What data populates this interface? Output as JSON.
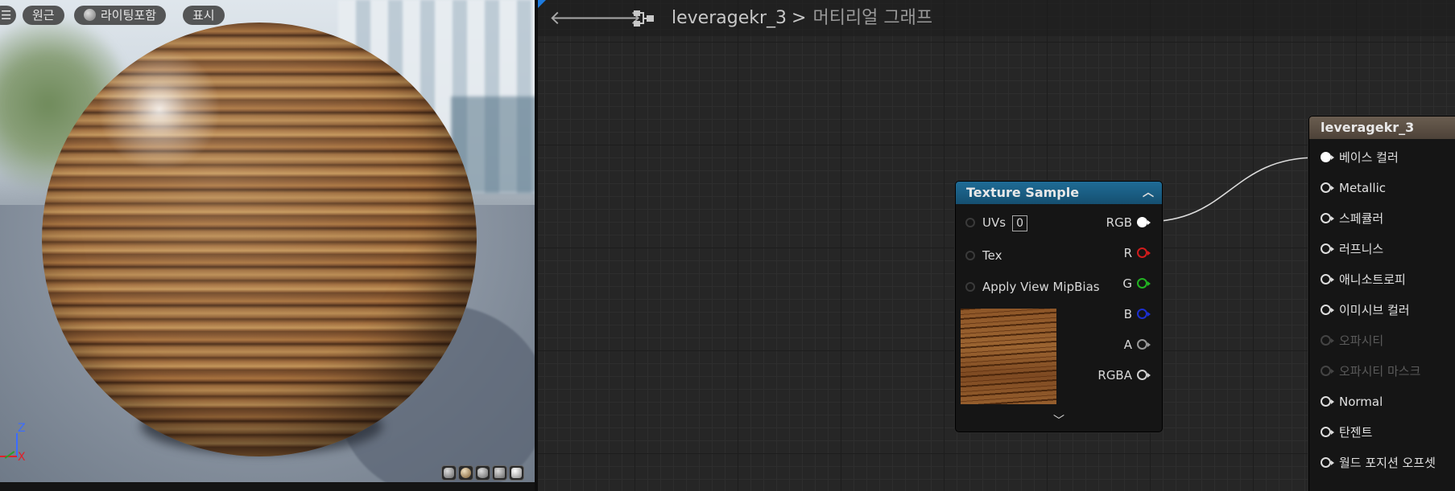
{
  "viewport": {
    "menu_icon": "hamburger-icon",
    "view_mode_label": "원근",
    "lighting_label": "라이팅포함",
    "show_label": "표시",
    "axis_z": "Z",
    "axis_x": "X",
    "preview_shapes": [
      "cylinder",
      "sphere",
      "plane",
      "cube",
      "teapot"
    ]
  },
  "toolbar": {
    "back_icon": "arrow-left-icon",
    "forward_icon": "arrow-right-icon",
    "graph_icon": "material-graph-icon",
    "breadcrumb_asset": "leveragekr_3",
    "breadcrumb_separator": ">",
    "breadcrumb_current": "머티리얼 그래프"
  },
  "texture_node": {
    "title": "Texture Sample",
    "inputs": [
      {
        "label": "UVs",
        "value": "0"
      },
      {
        "label": "Tex"
      },
      {
        "label": "Apply View MipBias"
      }
    ],
    "outputs": [
      {
        "label": "RGB",
        "color": "#ffffff",
        "connected": true
      },
      {
        "label": "R",
        "color": "#d21c1c"
      },
      {
        "label": "G",
        "color": "#22b322"
      },
      {
        "label": "B",
        "color": "#1c2fd2"
      },
      {
        "label": "A",
        "color": "#9a9a9a"
      },
      {
        "label": "RGBA",
        "color": "#d0d0d0"
      }
    ]
  },
  "result_node": {
    "title": "leveragekr_3",
    "pins": [
      {
        "label": "베이스 컬러",
        "connected": true
      },
      {
        "label": "Metallic"
      },
      {
        "label": "스페큘러"
      },
      {
        "label": "러프니스"
      },
      {
        "label": "애니소트로피"
      },
      {
        "label": "이미시브 컬러"
      },
      {
        "label": "오파시티",
        "disabled": true
      },
      {
        "label": "오파시티 마스크",
        "disabled": true
      },
      {
        "label": "Normal"
      },
      {
        "label": "탄젠트"
      },
      {
        "label": "월드 포지션 오프셋"
      }
    ]
  },
  "colors": {
    "texture_header": "#1f6c96",
    "result_header": "#5c5045",
    "graph_bg": "#262626"
  }
}
